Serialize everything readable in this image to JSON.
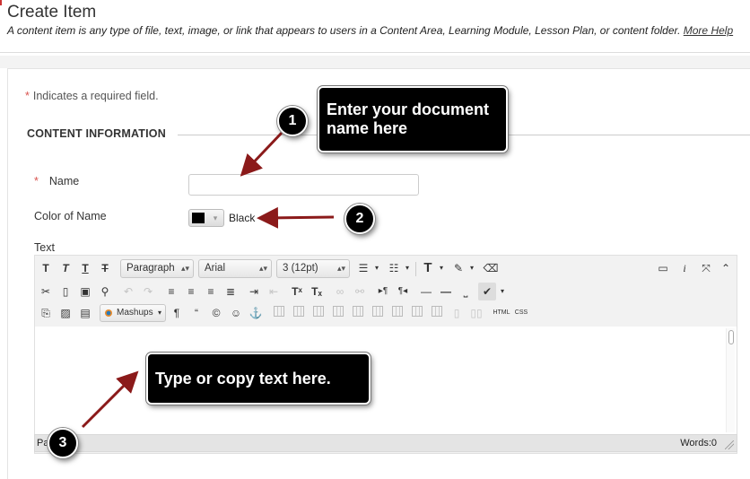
{
  "header": {
    "title": "Create Item",
    "description": "A content item is any type of file, text, image, or link that appears to users in a Content Area, Learning Module, Lesson Plan, or content folder.",
    "more_help": "More Help"
  },
  "form": {
    "required_star": "*",
    "required_note": "Indicates a required field.",
    "section_title": "CONTENT INFORMATION",
    "name_label": "Name",
    "name_value": "",
    "color_label": "Color of Name",
    "color_value": "Black",
    "color_swatch": "#000000",
    "text_label": "Text"
  },
  "toolbar": {
    "paragraph": "Paragraph",
    "font": "Arial",
    "size": "3 (12pt)",
    "mashups": "Mashups",
    "html_label": "HTML",
    "css_label": "CSS"
  },
  "editor": {
    "path": "Pa",
    "word_count": "Words:0"
  },
  "callouts": {
    "c1_text": "Enter your document name here",
    "c2_text": "Type or copy text here.",
    "b1": "1",
    "b2": "2",
    "b3": "3",
    "callout_color": "#000000",
    "arrow_color": "#8b1a1a"
  }
}
